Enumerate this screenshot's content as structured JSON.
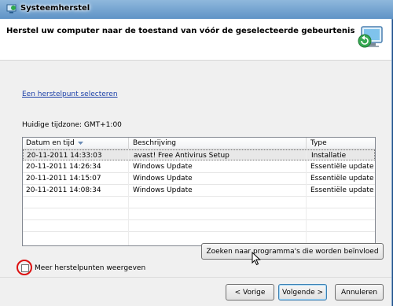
{
  "window": {
    "title": "Systeemherstel"
  },
  "header": {
    "title": "Herstel uw computer naar de toestand van vóór de geselecteerde gebeurtenis"
  },
  "select_link": "Een herstelpunt selecteren",
  "timezone": "Huidige tijdzone: GMT+1:00",
  "table": {
    "columns": [
      "Datum en tijd",
      "Beschrijving",
      "Type"
    ],
    "rows": [
      {
        "date": "20-11-2011 14:33:03",
        "desc": "avast! Free Antivirus Setup",
        "type": "Installatie"
      },
      {
        "date": "20-11-2011 14:26:34",
        "desc": "Windows Update",
        "type": "Essentiële update"
      },
      {
        "date": "20-11-2011 14:15:07",
        "desc": "Windows Update",
        "type": "Essentiële update"
      },
      {
        "date": "20-11-2011 14:08:34",
        "desc": "Windows Update",
        "type": "Essentiële update"
      }
    ]
  },
  "more_points_label": "Meer herstelpunten weergeven",
  "buttons": {
    "scan": "Zoeken naar programma's die worden beïnvloed",
    "back": "< Vorige",
    "next": "Volgende >",
    "cancel": "Annuleren"
  }
}
